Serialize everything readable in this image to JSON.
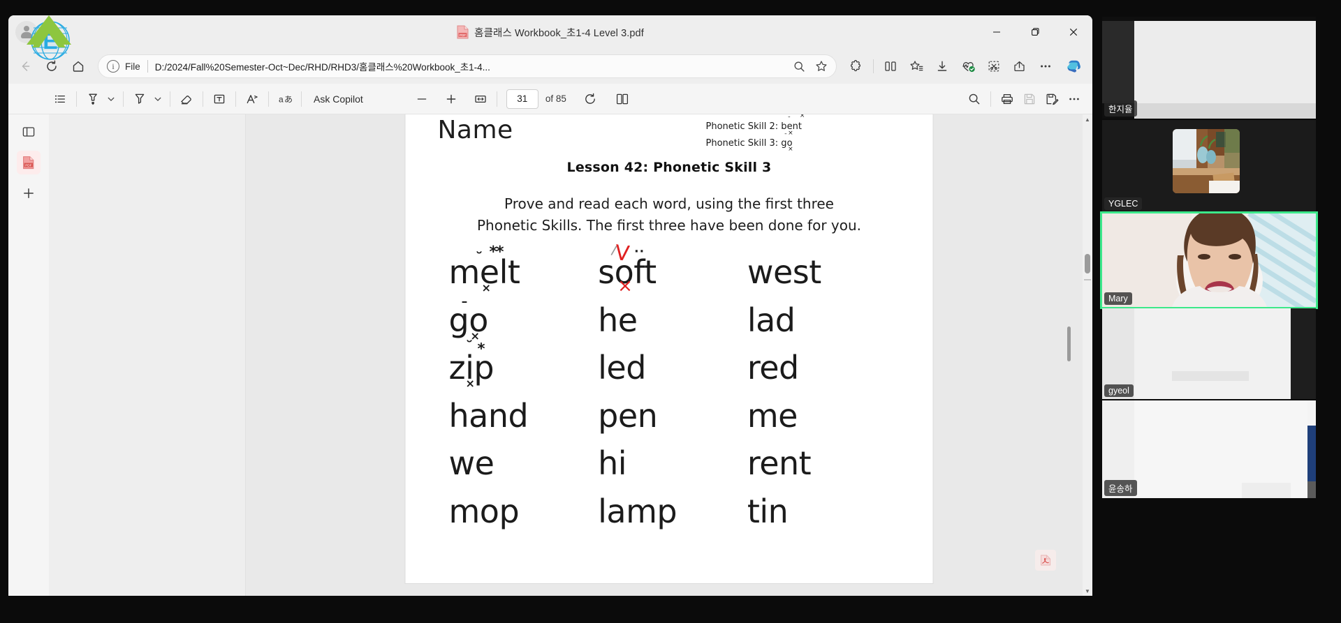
{
  "window": {
    "title": "홈클래스 Workbook_초1-4 Level 3.pdf",
    "minimize_label": "Minimize",
    "maximize_label": "Restore",
    "close_label": "Close"
  },
  "nav": {
    "back_label": "Back",
    "forward_label": "Forward",
    "refresh_label": "Refresh",
    "home_label": "Home"
  },
  "address": {
    "scheme_label": "File",
    "url": "D:/2024/Fall%20Semester-Oct~Dec/RHD/RHD3/홈클래스%20Workbook_초1-4...",
    "zoom_label": "Zoom",
    "favorite_label": "Add to favorites"
  },
  "browser_toolbar": {
    "extensions": "extensions-icon",
    "split_screen": "split-screen-icon",
    "favorites": "favorites-icon",
    "downloads": "downloads-icon",
    "browser_essentials": "browser-essentials-icon",
    "screenshot": "screenshot-icon",
    "share": "share-icon",
    "settings_more": "more-settings-icon",
    "copilot": "copilot-icon"
  },
  "pdf_toolbar": {
    "toc_label": "Table of contents",
    "highlight_label": "Highlight",
    "highlight_caret": "˅",
    "erase_highlight_label": "Highlight color",
    "erase_caret": "˅",
    "eraser_label": "Erase",
    "text_label": "Add text",
    "draw_label": "Draw",
    "read_aloud_label": "Read aloud",
    "translate_label": "Translate",
    "ask_copilot_label": "Ask Copilot",
    "zoom_out_label": "Zoom out",
    "zoom_in_label": "Zoom in",
    "fit_page_label": "Fit to page",
    "page_current": "31",
    "page_total": "of 85",
    "rotate_label": "Rotate",
    "page_view_label": "Page view",
    "search_label": "Search",
    "print_label": "Print",
    "save_label": "Save",
    "save_as_label": "Save as",
    "more_label": "More options"
  },
  "left_rail": {
    "items": [
      {
        "name": "panel-toggle",
        "icon": "sidebar-icon"
      },
      {
        "name": "pdf-file",
        "icon": "pdf-file-icon",
        "active": true
      },
      {
        "name": "add-tab",
        "icon": "plus-icon"
      }
    ]
  },
  "document": {
    "name_label": "Name",
    "skills": [
      {
        "prefix": "Phonetic Skill 2: ",
        "word": "bent"
      },
      {
        "prefix": "Phonetic Skill 3: ",
        "word": "go"
      }
    ],
    "lesson_title": "Lesson 42: Phonetic Skill 3",
    "instruction_line1": "Prove and read each word, using the first three",
    "instruction_line2": "Phonetic Skills. The first three have been done for you.",
    "words": [
      [
        "melt",
        "soft",
        "west"
      ],
      [
        "go",
        "he",
        "lad"
      ],
      [
        "zip",
        "led",
        "red"
      ],
      [
        "hand",
        "pen",
        "me"
      ],
      [
        "we",
        "hi",
        "rent"
      ],
      [
        "mop",
        "lamp",
        "tin"
      ]
    ],
    "annotations": {
      "melt": [
        "breve-over-e",
        "double-asterisk",
        "x-under-l"
      ],
      "soft": [
        "red-check-over-o",
        "red-x-under-o",
        "two-dots"
      ],
      "go": [
        "macron-over-o",
        "x-under-o"
      ],
      "zip": [
        "breve-over-i",
        "asterisk",
        "x-under-p"
      ]
    },
    "acrobat_badge": "acrobat-icon"
  },
  "video_panel": {
    "participants": [
      {
        "name": "한지율",
        "active": false
      },
      {
        "name": "YGLEC",
        "active": false
      },
      {
        "name": "Mary",
        "active": true
      },
      {
        "name": "gyeol",
        "active": false
      },
      {
        "name": "윤송하",
        "active": false
      }
    ],
    "active_border_color": "#3ce88a"
  }
}
